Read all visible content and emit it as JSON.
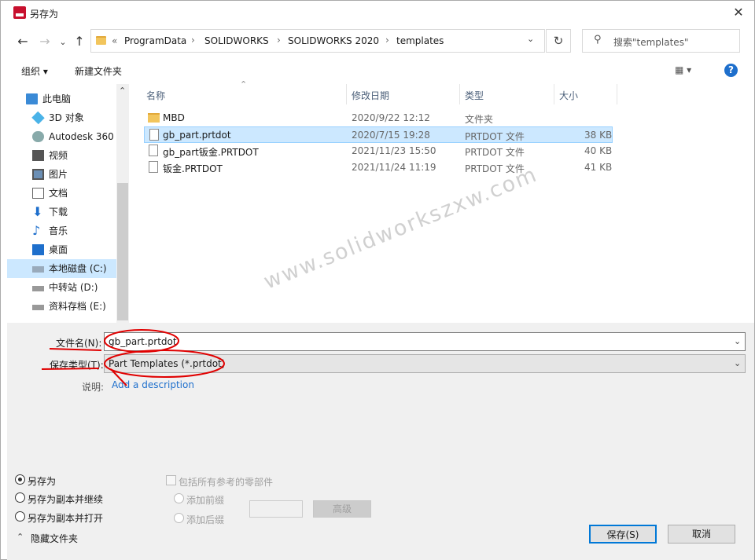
{
  "window": {
    "title": "另存为",
    "close": "✕"
  },
  "nav": {
    "back": "←",
    "forward": "→",
    "up_arrow": "↑",
    "down_chevron": "⌄",
    "up": "↑"
  },
  "address": {
    "prefix": "«",
    "crumbs": [
      "ProgramData",
      "SOLIDWORKS",
      "SOLIDWORKS 2020",
      "templates"
    ],
    "sep": "›",
    "dropdown": "⌄",
    "refresh": "↻"
  },
  "search": {
    "placeholder": "搜索\"templates\"",
    "icon": "⚲"
  },
  "toolbar": {
    "organize": "组织 ▾",
    "new_folder": "新建文件夹",
    "view": "▦ ▾",
    "help": "?"
  },
  "sidebar": {
    "items": [
      {
        "label": "此电脑",
        "icon": "computer-icon"
      },
      {
        "label": "3D 对象",
        "icon": "cube-icon"
      },
      {
        "label": "Autodesk 360",
        "icon": "cloud-icon"
      },
      {
        "label": "视频",
        "icon": "video-icon"
      },
      {
        "label": "图片",
        "icon": "picture-icon"
      },
      {
        "label": "文档",
        "icon": "document-icon"
      },
      {
        "label": "下载",
        "icon": "download-icon"
      },
      {
        "label": "音乐",
        "icon": "music-icon"
      },
      {
        "label": "桌面",
        "icon": "desktop-icon"
      },
      {
        "label": "本地磁盘 (C:)",
        "icon": "drive-icon"
      },
      {
        "label": "中转站 (D:)",
        "icon": "drive-icon"
      },
      {
        "label": "资料存档 (E:)",
        "icon": "drive-icon"
      }
    ],
    "scroll_up": "⌃"
  },
  "columns": {
    "name": "名称",
    "date": "修改日期",
    "type": "类型",
    "size": "大小",
    "sort": "⌃"
  },
  "files": [
    {
      "name": "MBD",
      "date": "2020/9/22 12:12",
      "type": "文件夹",
      "size": ""
    },
    {
      "name": "gb_part.prtdot",
      "date": "2020/7/15 19:28",
      "type": "PRTDOT 文件",
      "size": "38 KB"
    },
    {
      "name": "gb_part钣金.PRTDOT",
      "date": "2021/11/23 15:50",
      "type": "PRTDOT 文件",
      "size": "40 KB"
    },
    {
      "name": "钣金.PRTDOT",
      "date": "2021/11/24 11:19",
      "type": "PRTDOT 文件",
      "size": "41 KB"
    }
  ],
  "watermark": "www.solidworkszxw.com",
  "form": {
    "filename_label": "文件名(N):",
    "filename_value": "gb_part.prtdot",
    "filetype_label": "保存类型(T):",
    "filetype_value": "Part Templates (*.prtdot)",
    "desc_label": "说明:",
    "desc_link": "Add a description",
    "dropdown": "⌄"
  },
  "options": {
    "save_as": "另存为",
    "save_copy_continue": "另存为副本并继续",
    "save_copy_open": "另存为副本并打开",
    "include_refs": "包括所有参考的零部件",
    "add_prefix": "添加前缀",
    "add_suffix": "添加后缀",
    "advanced": "高级",
    "hide_folders": "隐藏文件夹",
    "hide_chevron": "⌃"
  },
  "buttons": {
    "save": "保存(S)",
    "cancel": "取消"
  }
}
